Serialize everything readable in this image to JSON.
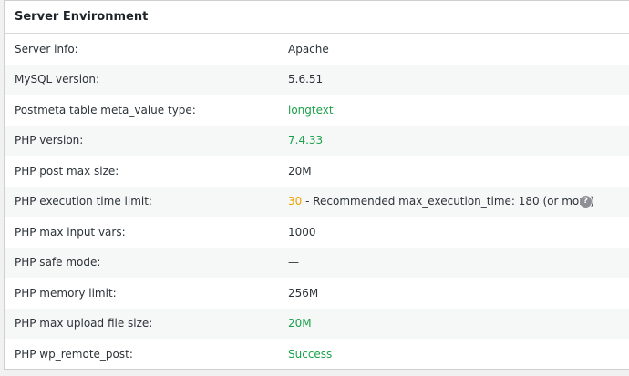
{
  "panel": {
    "title": "Server Environment"
  },
  "rows": [
    {
      "label": "Server info:",
      "value": "Apache"
    },
    {
      "label": "MySQL version:",
      "value": "5.6.51"
    },
    {
      "label": "Postmeta table meta_value type:",
      "value": "longtext"
    },
    {
      "label": "PHP version:",
      "value": "7.4.33"
    },
    {
      "label": "PHP post max size:",
      "value": "20M"
    },
    {
      "label": "PHP execution time limit:",
      "value": "30",
      "note": " - Recommended max_execution_time: 180 (or more)"
    },
    {
      "label": "PHP max input vars:",
      "value": "1000"
    },
    {
      "label": "PHP safe mode:",
      "value": "—"
    },
    {
      "label": "PHP memory limit:",
      "value": "256M"
    },
    {
      "label": "PHP max upload file size:",
      "value": "20M"
    },
    {
      "label": "PHP wp_remote_post:",
      "value": "Success"
    }
  ],
  "help_icon": {
    "glyph": "?",
    "name": "help-icon"
  },
  "colors": {
    "success": "#1aa14a",
    "warning": "#f0a000",
    "text": "#2c3338"
  }
}
